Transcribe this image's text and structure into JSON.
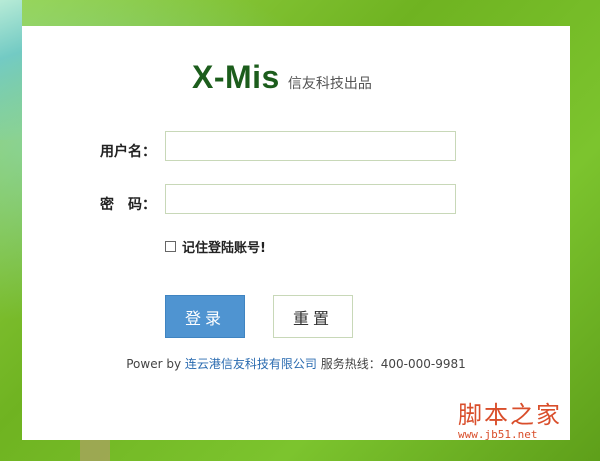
{
  "logo": {
    "main": "X-Mis",
    "sub": "信友科技出品"
  },
  "form": {
    "username_label": "用户名：",
    "username_value": "",
    "password_label": "密　码：",
    "password_value": "",
    "remember_label": "记住登陆账号!",
    "remember_checked": false
  },
  "buttons": {
    "login": "登录",
    "reset": "重置"
  },
  "footer": {
    "prefix": "Power by ",
    "company": "连云港信友科技有限公司",
    "hotline": " 服务热线：400-000-9981"
  },
  "watermark": {
    "name": "脚本之家",
    "url": "www.jb51.net"
  },
  "colors": {
    "accent": "#4f94d1",
    "brand_green": "#1c5d1c",
    "background": "#79c02a"
  }
}
